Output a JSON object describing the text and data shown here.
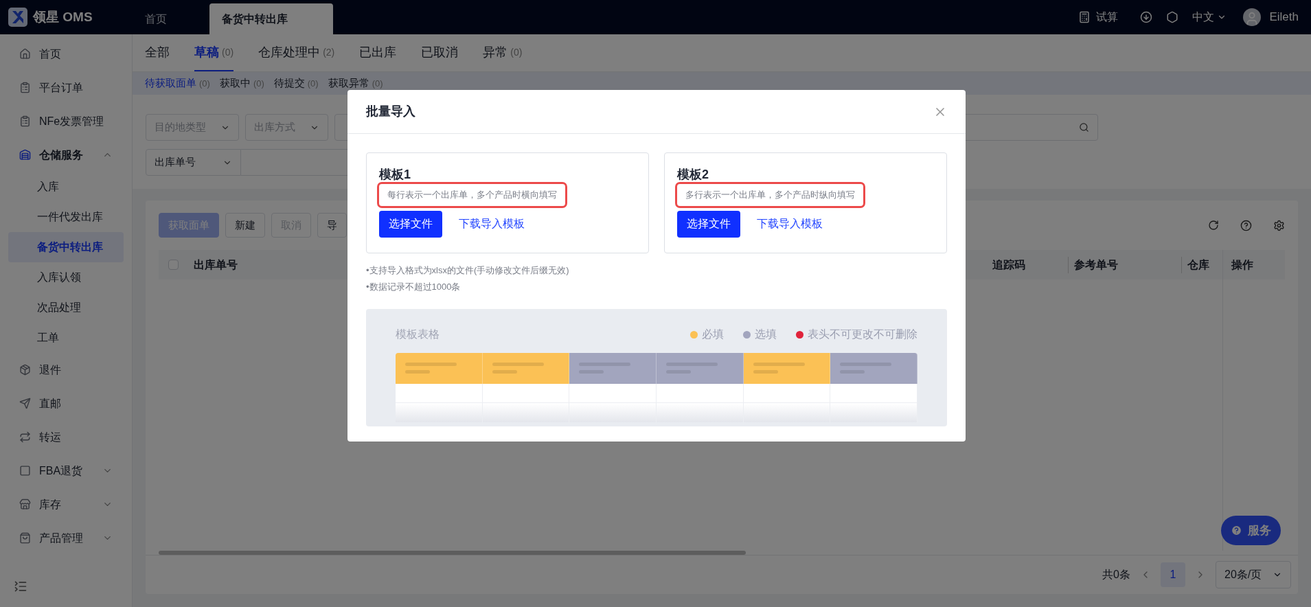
{
  "app": {
    "logo_text": "领星 OMS"
  },
  "top_tabs": [
    {
      "label": "首页",
      "selected": false
    },
    {
      "label": "备货中转出库",
      "selected": true
    }
  ],
  "top_actions": {
    "calc": "试算",
    "language": "中文",
    "user": "Eileth"
  },
  "sidebar": {
    "items": [
      {
        "label": "首页",
        "selected": false
      },
      {
        "label": "平台订单",
        "selected": false
      },
      {
        "label": "NFe发票管理",
        "selected": false
      },
      {
        "label": "仓储服务",
        "selected": false,
        "expanded": true,
        "children": [
          {
            "label": "入库",
            "selected": false
          },
          {
            "label": "一件代发出库",
            "selected": false
          },
          {
            "label": "备货中转出库",
            "selected": true
          },
          {
            "label": "入库认领",
            "selected": false
          },
          {
            "label": "次品处理",
            "selected": false
          },
          {
            "label": "工单",
            "selected": false
          }
        ]
      },
      {
        "label": "退件",
        "selected": false
      },
      {
        "label": "直邮",
        "selected": false
      },
      {
        "label": "转运",
        "selected": false
      },
      {
        "label": "FBA退货",
        "selected": false,
        "expanded": false
      },
      {
        "label": "库存",
        "selected": false,
        "expanded": false
      },
      {
        "label": "产品管理",
        "selected": false,
        "expanded": false
      }
    ]
  },
  "status_tabs": [
    {
      "label": "全部",
      "selected": false
    },
    {
      "label": "草稿",
      "count": "(0)",
      "selected": true
    },
    {
      "label": "仓库处理中",
      "count": "(2)",
      "selected": false
    },
    {
      "label": "已出库",
      "selected": false
    },
    {
      "label": "已取消",
      "selected": false
    },
    {
      "label": "异常",
      "count": "(0)",
      "selected": false
    }
  ],
  "sub_tabs": [
    {
      "label": "待获取面单",
      "count": "(0)",
      "selected": true
    },
    {
      "label": "获取中",
      "count": "(0)",
      "selected": false
    },
    {
      "label": "待提交",
      "count": "(0)",
      "selected": false
    },
    {
      "label": "获取异常",
      "count": "(0)",
      "selected": false
    }
  ],
  "filters": {
    "selects": [
      {
        "placeholder": "目的地类型"
      },
      {
        "placeholder": "出库方式"
      }
    ],
    "search_type": "出库单号"
  },
  "actions": [
    {
      "label": "获取面单",
      "kind": "primary",
      "disabled": true
    },
    {
      "label": "新建",
      "kind": "default",
      "disabled": false
    },
    {
      "label": "取消",
      "kind": "default",
      "disabled": true
    },
    {
      "label": "导",
      "kind": "default",
      "disabled": false
    }
  ],
  "table": {
    "select_all_checked": false,
    "columns": [
      {
        "label": "出库单号"
      },
      {
        "label": "追踪码"
      },
      {
        "label": "参考单号"
      },
      {
        "label": "仓库"
      },
      {
        "label": "操作"
      }
    ]
  },
  "pagination": {
    "total": "共0条",
    "pages": [
      {
        "label": "1",
        "selected": true
      }
    ],
    "page_size": "20条/页"
  },
  "service_button": "服务",
  "modal": {
    "title": "批量导入",
    "templates": [
      {
        "title": "模板1",
        "description": "每行表示一个出库单，多个产品时横向填写",
        "highlighted": true,
        "button": "选择文件",
        "link": "下载导入模板"
      },
      {
        "title": "模板2",
        "description": "多行表示一个出库单，多个产品时纵向填写",
        "highlighted": true,
        "button": "选择文件",
        "link": "下载导入模板"
      }
    ],
    "notes": [
      "•支持导入格式为xlsx的文件(手动修改文件后缀无效)",
      "•数据记录不超过1000条"
    ],
    "preview": {
      "title": "模板表格",
      "legend": [
        {
          "label": "必填",
          "color": "#fbc155"
        },
        {
          "label": "选填",
          "color": "#a2a5be"
        },
        {
          "label": "表头不可更改不可删除",
          "color": "#e0233b"
        }
      ],
      "columns": [
        {
          "color": "#fbc155"
        },
        {
          "color": "#fbc155"
        },
        {
          "color": "#a2a5be"
        },
        {
          "color": "#a2a5be"
        },
        {
          "color": "#fbc155"
        },
        {
          "color": "#a2a5be"
        }
      ]
    }
  }
}
